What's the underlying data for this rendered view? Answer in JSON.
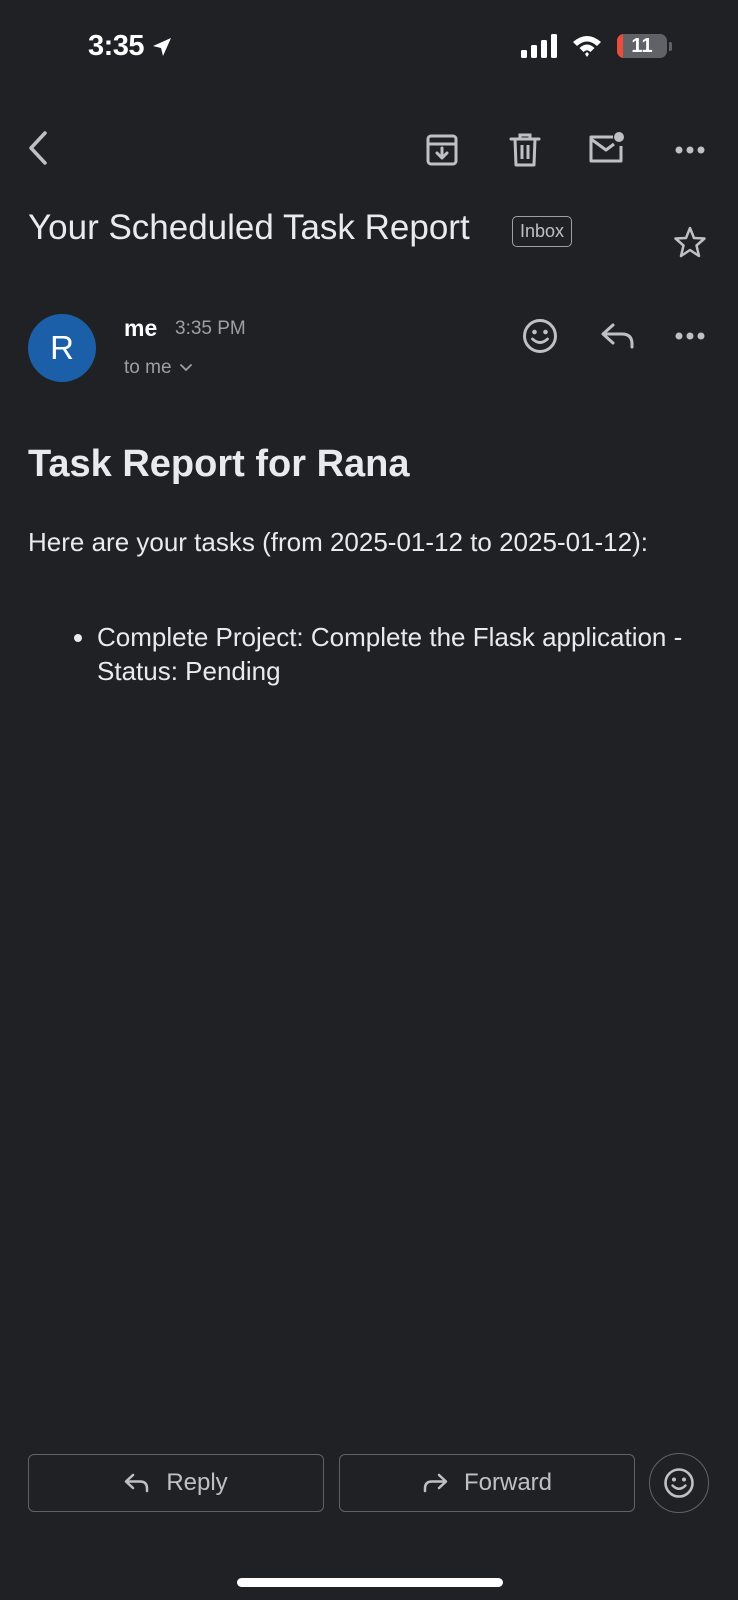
{
  "status_bar": {
    "time": "3:35",
    "battery_level": "11",
    "icons": [
      "location-arrow-icon",
      "cellular-signal-icon",
      "wifi-icon",
      "battery-icon"
    ]
  },
  "toolbar": {
    "icons": [
      "back-arrow-icon",
      "archive-icon",
      "trash-icon",
      "mark-unread-icon",
      "more-icon"
    ]
  },
  "email": {
    "subject": "Your Scheduled Task Report",
    "label": "Inbox",
    "sender": {
      "avatar_letter": "R",
      "avatar_color": "#1a5fa8",
      "name": "me",
      "time": "3:35 PM",
      "recipient": "to me"
    },
    "body": {
      "heading": "Task Report for Rana",
      "intro": "Here are your tasks (from 2025-01-12 to 2025-01-12):",
      "tasks": [
        "Complete Project: Complete the Flask application - Status: Pending"
      ]
    }
  },
  "actions": {
    "reply_label": "Reply",
    "forward_label": "Forward"
  },
  "colors": {
    "background": "#202124",
    "text": "#e8eaed",
    "muted": "#9aa0a6",
    "battery_low": "#eb4d3d"
  }
}
